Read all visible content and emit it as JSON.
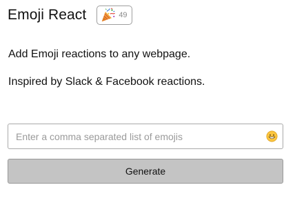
{
  "header": {
    "title": "Emoji React",
    "badge": {
      "icon": "party-popper-icon",
      "count": "49"
    }
  },
  "description": {
    "line1": "Add Emoji reactions to any webpage.",
    "line2": "Inspired by Slack & Facebook reactions."
  },
  "form": {
    "input_value": "",
    "input_placeholder": "Enter a comma separated list of emojis",
    "picker_icon": "smiley-face-icon",
    "generate_label": "Generate"
  },
  "colors": {
    "button_background": "#c4c4c4",
    "border": "#a9a9a9",
    "placeholder": "#9a9a9a"
  }
}
